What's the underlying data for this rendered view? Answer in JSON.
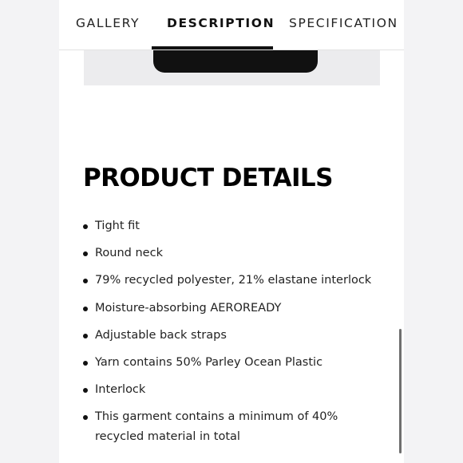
{
  "tabs": [
    {
      "label": "GALLERY",
      "active": false
    },
    {
      "label": "DESCRIPTION",
      "active": true
    },
    {
      "label": "SPECIFICATION",
      "active": false
    }
  ],
  "section": {
    "title": "PRODUCT DETAILS"
  },
  "details": [
    "Tight fit",
    "Round neck",
    "79% recycled polyester, 21% elastane interlock",
    "Moisture-absorbing AEROREADY",
    "Adjustable back straps",
    "Yarn contains 50% Parley Ocean Plastic",
    "Interlock",
    "This garment contains a minimum of 40% recycled material in total"
  ],
  "colors": {
    "accent": "#111111",
    "image_background": "#ececee",
    "page_background": "#f3f3f5"
  }
}
